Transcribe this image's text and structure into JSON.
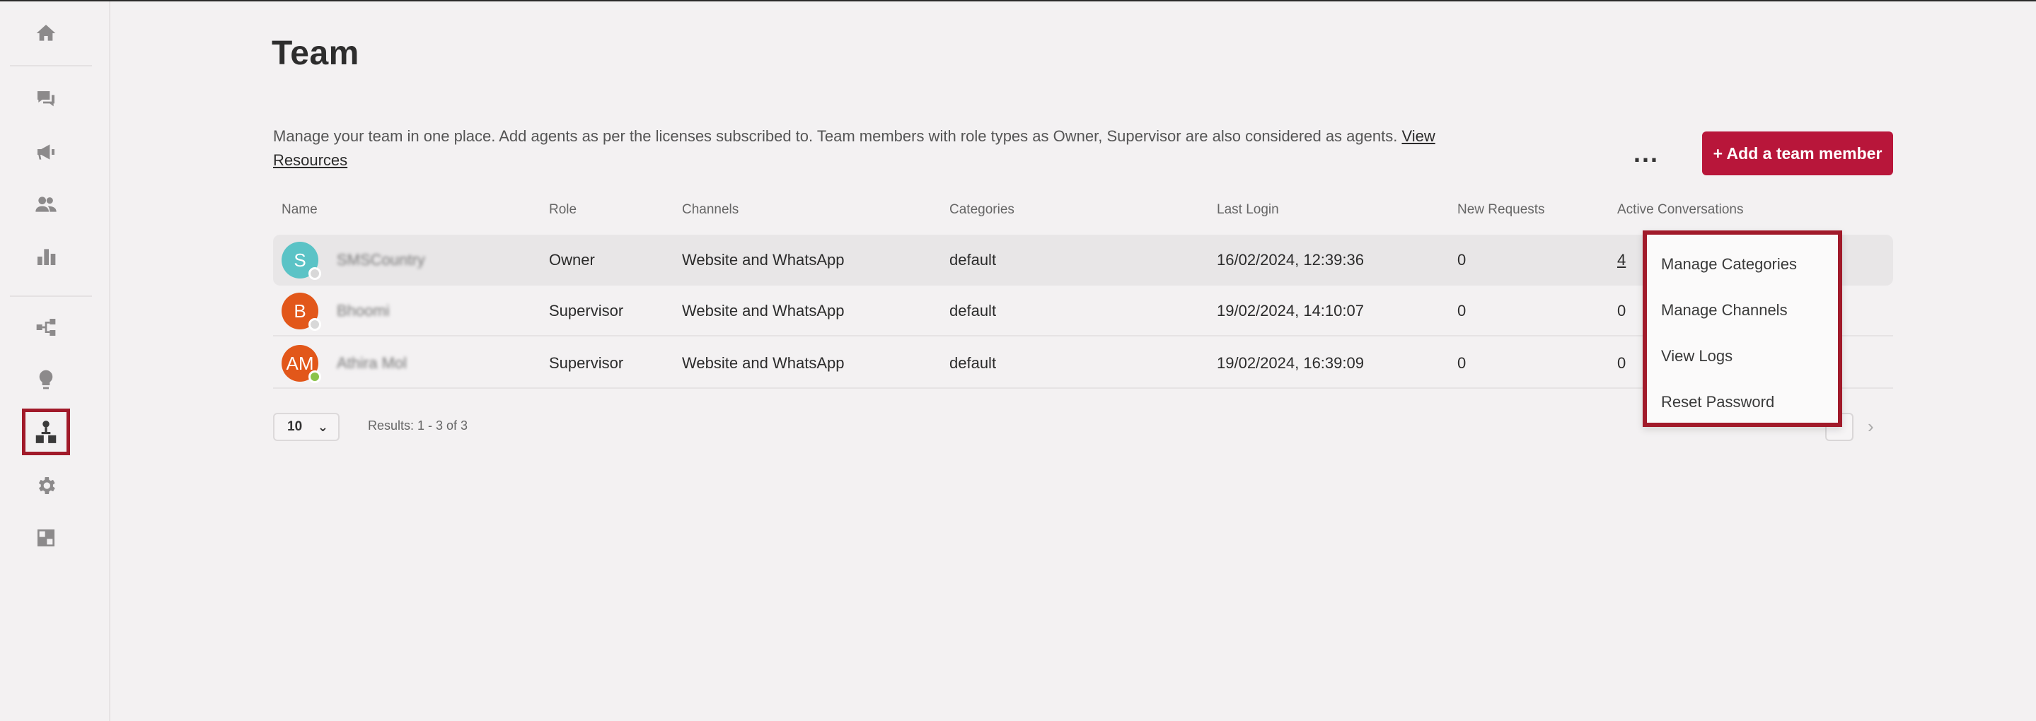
{
  "page": {
    "title": "Team",
    "description": "Manage your team in one place. Add agents as per the licenses subscribed to. Team members with role types as Owner, Supervisor are also considered as agents.",
    "resources_link": "View Resources",
    "more_button": "...",
    "add_button": "+ Add a team member"
  },
  "sidebar": {
    "items": [
      {
        "icon": "home-icon"
      },
      {
        "icon": "conversations-icon"
      },
      {
        "icon": "megaphone-icon"
      },
      {
        "icon": "contacts-icon"
      },
      {
        "icon": "analytics-icon"
      },
      {
        "icon": "flows-icon"
      },
      {
        "icon": "lightbulb-icon"
      },
      {
        "icon": "team-icon",
        "selected": true
      },
      {
        "icon": "gear-icon"
      },
      {
        "icon": "integrations-icon"
      }
    ]
  },
  "table": {
    "columns": [
      "Name",
      "Role",
      "Channels",
      "Categories",
      "Last Login",
      "New Requests",
      "Active Conversations"
    ],
    "rows": [
      {
        "initials": "S",
        "avatar_color": "#5bc3c6",
        "status_color": "#d8d8d8",
        "name": "SMSCountry",
        "role": "Owner",
        "channels": "Website and WhatsApp",
        "categories": "default",
        "last_login": "16/02/2024, 12:39:36",
        "new_requests": "0",
        "active_conversations": "4"
      },
      {
        "initials": "B",
        "avatar_color": "#e2571a",
        "status_color": "#d8d8d8",
        "name": "Bhoomi",
        "role": "Supervisor",
        "channels": "Website and WhatsApp",
        "categories": "default",
        "last_login": "19/02/2024, 14:10:07",
        "new_requests": "0",
        "active_conversations": "0"
      },
      {
        "initials": "AM",
        "avatar_color": "#e2571a",
        "status_color": "#8bc34a",
        "name": "Athira Mol",
        "role": "Supervisor",
        "channels": "Website and WhatsApp",
        "categories": "default",
        "last_login": "19/02/2024, 16:39:09",
        "new_requests": "0",
        "active_conversations": "0"
      }
    ]
  },
  "pagination": {
    "per_page": "10",
    "results": "Results: 1 - 3 of 3",
    "next_icon": "chevron-right-icon"
  },
  "menu": {
    "items": [
      "Manage Categories",
      "Manage Channels",
      "View Logs",
      "Reset Password"
    ]
  },
  "colors": {
    "accent": "#b8163a",
    "highlight_border": "#a11a2a"
  }
}
